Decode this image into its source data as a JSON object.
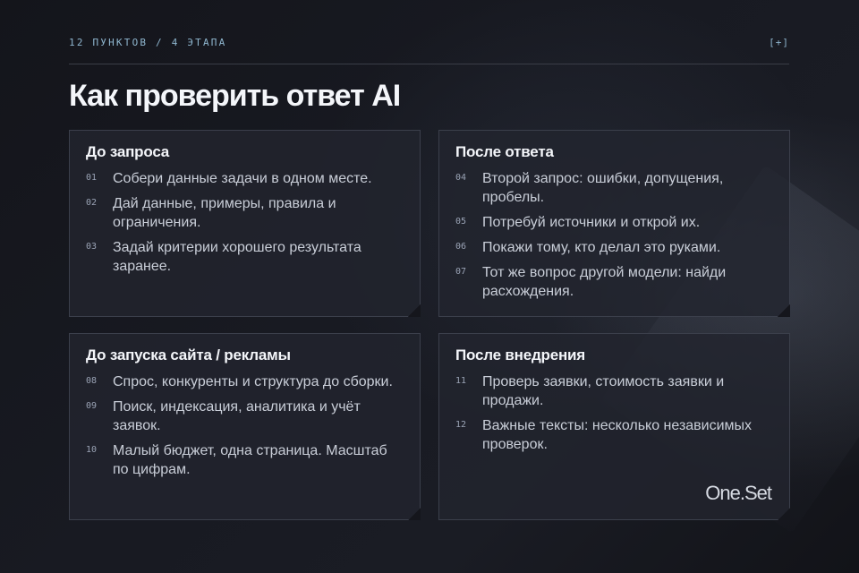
{
  "header": {
    "meta": "12 ПУНКТОВ / 4 ЭТАПА",
    "plus_label": "[+]"
  },
  "title": "Как проверить ответ AI",
  "cards": [
    {
      "title": "До запроса",
      "items": [
        {
          "num": "01",
          "text": "Собери данные задачи в одном месте."
        },
        {
          "num": "02",
          "text": "Дай данные, примеры, правила и ограничения."
        },
        {
          "num": "03",
          "text": "Задай критерии хорошего результата заранее."
        }
      ]
    },
    {
      "title": "После ответа",
      "items": [
        {
          "num": "04",
          "text": "Второй запрос: ошибки, допущения, пробелы."
        },
        {
          "num": "05",
          "text": "Потребуй источники и открой их."
        },
        {
          "num": "06",
          "text": "Покажи тому, кто делал это руками."
        },
        {
          "num": "07",
          "text": "Тот же вопрос другой модели: найди расхождения."
        }
      ]
    },
    {
      "title": "До запуска сайта / рекламы",
      "items": [
        {
          "num": "08",
          "text": "Спрос, конкуренты и структура до сборки."
        },
        {
          "num": "09",
          "text": "Поиск, индексация, аналитика и учёт заявок."
        },
        {
          "num": "10",
          "text": "Малый бюджет, одна страница. Масштаб по цифрам."
        }
      ]
    },
    {
      "title": "После внедрения",
      "items": [
        {
          "num": "11",
          "text": "Проверь заявки, стоимость заявки и продажи."
        },
        {
          "num": "12",
          "text": "Важные тексты: несколько независимых проверок."
        }
      ]
    }
  ],
  "logo": "One.Set"
}
